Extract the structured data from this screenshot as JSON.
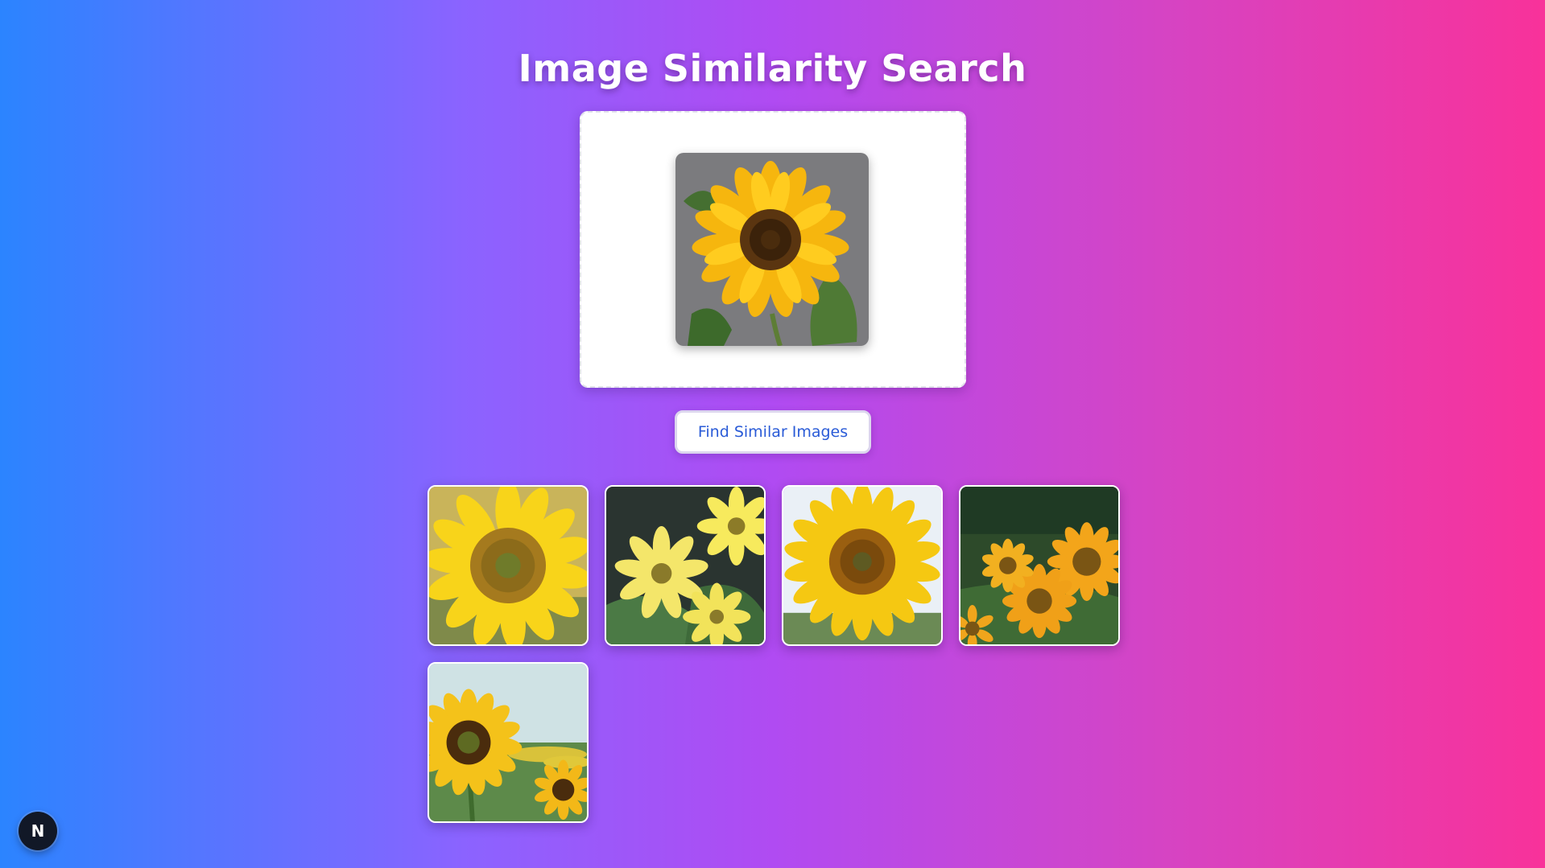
{
  "page": {
    "title": "Image Similarity Search"
  },
  "upload": {
    "preview_image": "sunflower-query-image"
  },
  "actions": {
    "find_label": "Find Similar Images"
  },
  "results": {
    "count": 5,
    "items": [
      {
        "image": "sunflower-closeup-result"
      },
      {
        "image": "yellow-daisy-flowers-result"
      },
      {
        "image": "sunflower-head-result"
      },
      {
        "image": "sunflower-field-cluster-result"
      },
      {
        "image": "sunflower-field-sky-result"
      }
    ]
  },
  "badge": {
    "label": "N",
    "icon": "nextjs-logo-icon"
  },
  "colors": {
    "gradient_start": "#2b84ff",
    "gradient_mid": "#b04bf2",
    "gradient_end": "#f8329a",
    "button_text": "#2a5bd7"
  }
}
